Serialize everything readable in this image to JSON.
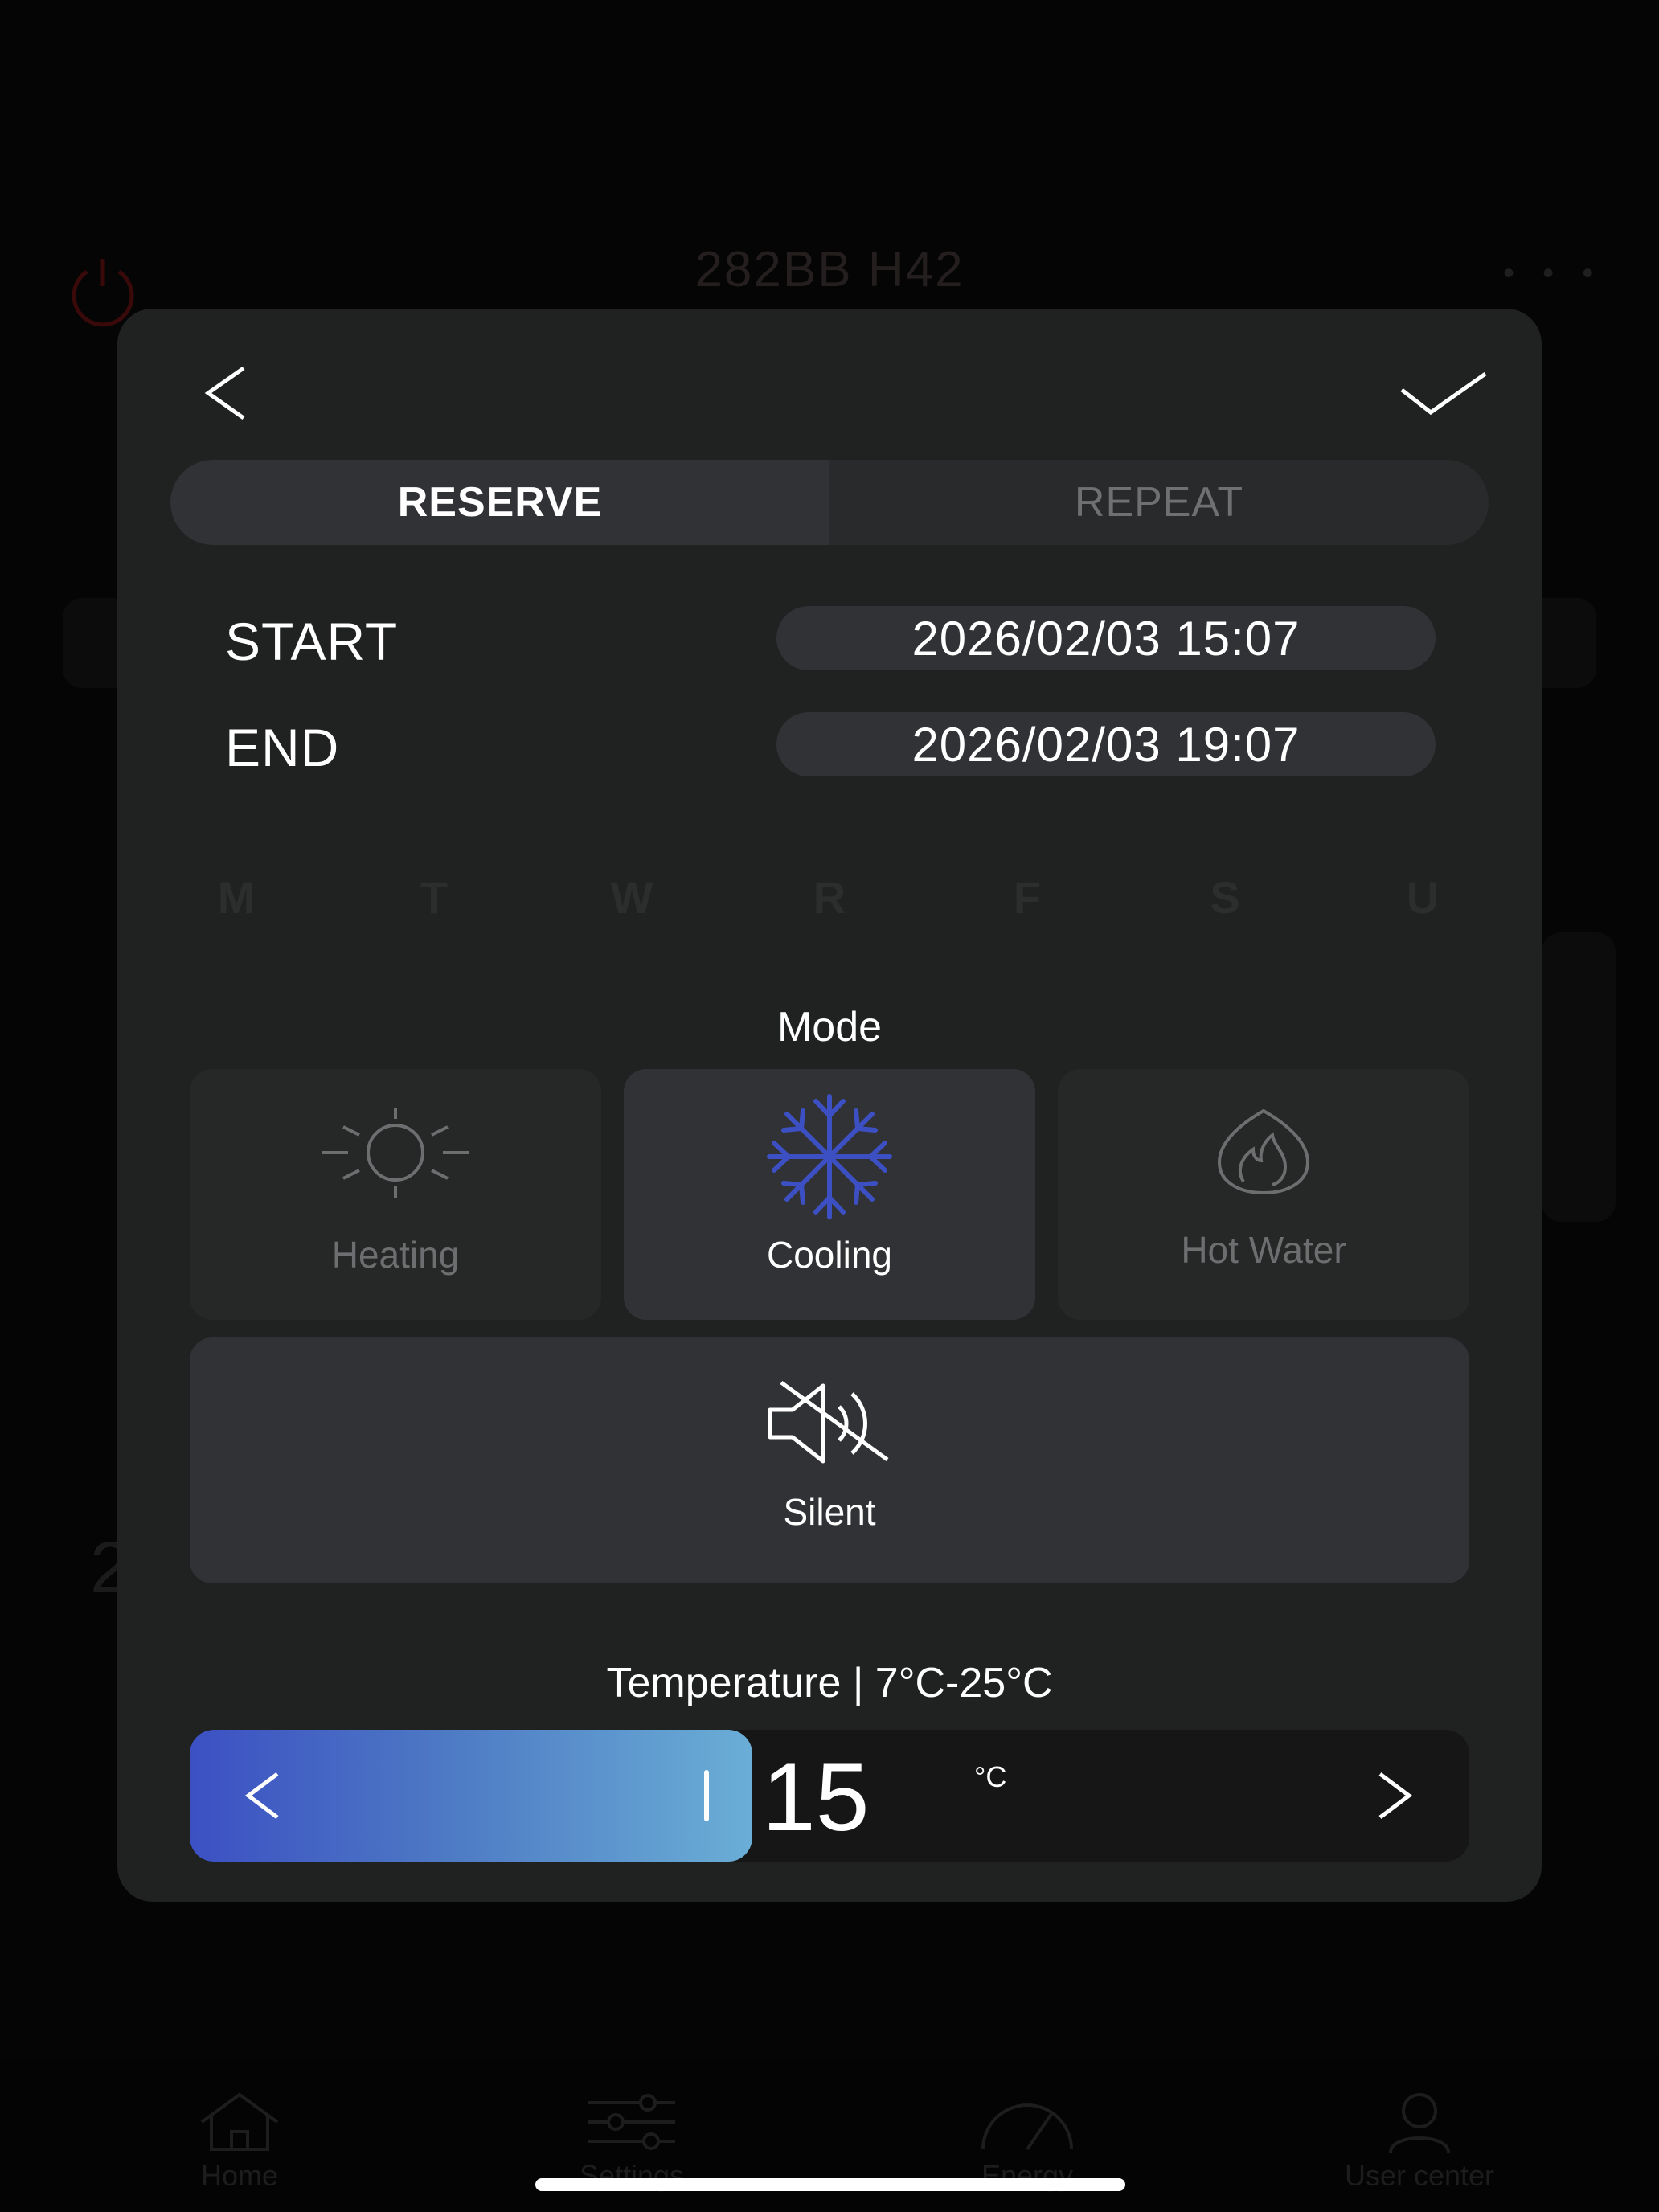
{
  "background": {
    "device_name": "282BB H42",
    "more_label": "• • •",
    "partial_value": "2",
    "tabs": [
      {
        "label": "Home",
        "icon": "home-icon"
      },
      {
        "label": "Settings",
        "icon": "sliders-icon"
      },
      {
        "label": "Energy",
        "icon": "energy-gauge-icon"
      },
      {
        "label": "User center",
        "icon": "user-icon"
      }
    ]
  },
  "modal": {
    "back_icon": "chevron-left-icon",
    "confirm_icon": "checkmark-icon",
    "segments": {
      "reserve": "RESERVE",
      "repeat": "REPEAT",
      "selected": "RESERVE"
    },
    "start": {
      "label": "START",
      "value": "2026/02/03 15:07"
    },
    "end": {
      "label": "END",
      "value": "2026/02/03 19:07"
    },
    "weekdays": [
      "M",
      "T",
      "W",
      "R",
      "F",
      "S",
      "U"
    ],
    "mode": {
      "title": "Mode",
      "options": [
        {
          "label": "Heating",
          "icon": "sun-icon",
          "selected": false
        },
        {
          "label": "Cooling",
          "icon": "snowflake-icon",
          "selected": true
        },
        {
          "label": "Hot Water",
          "icon": "flame-icon",
          "selected": false
        }
      ],
      "silent": {
        "label": "Silent",
        "icon": "speaker-muted-icon"
      }
    },
    "temperature": {
      "title": "Temperature | 7°C-25°C",
      "min": 7,
      "max": 25,
      "value": "15",
      "unit": "°C",
      "fill_fraction": 0.44
    }
  },
  "colors": {
    "accent_blue": "#3c50c3",
    "gradient_end": "#6aaed6",
    "modal_bg": "#202121",
    "card_bg": "#313235",
    "power_red": "#3a0a0a"
  }
}
